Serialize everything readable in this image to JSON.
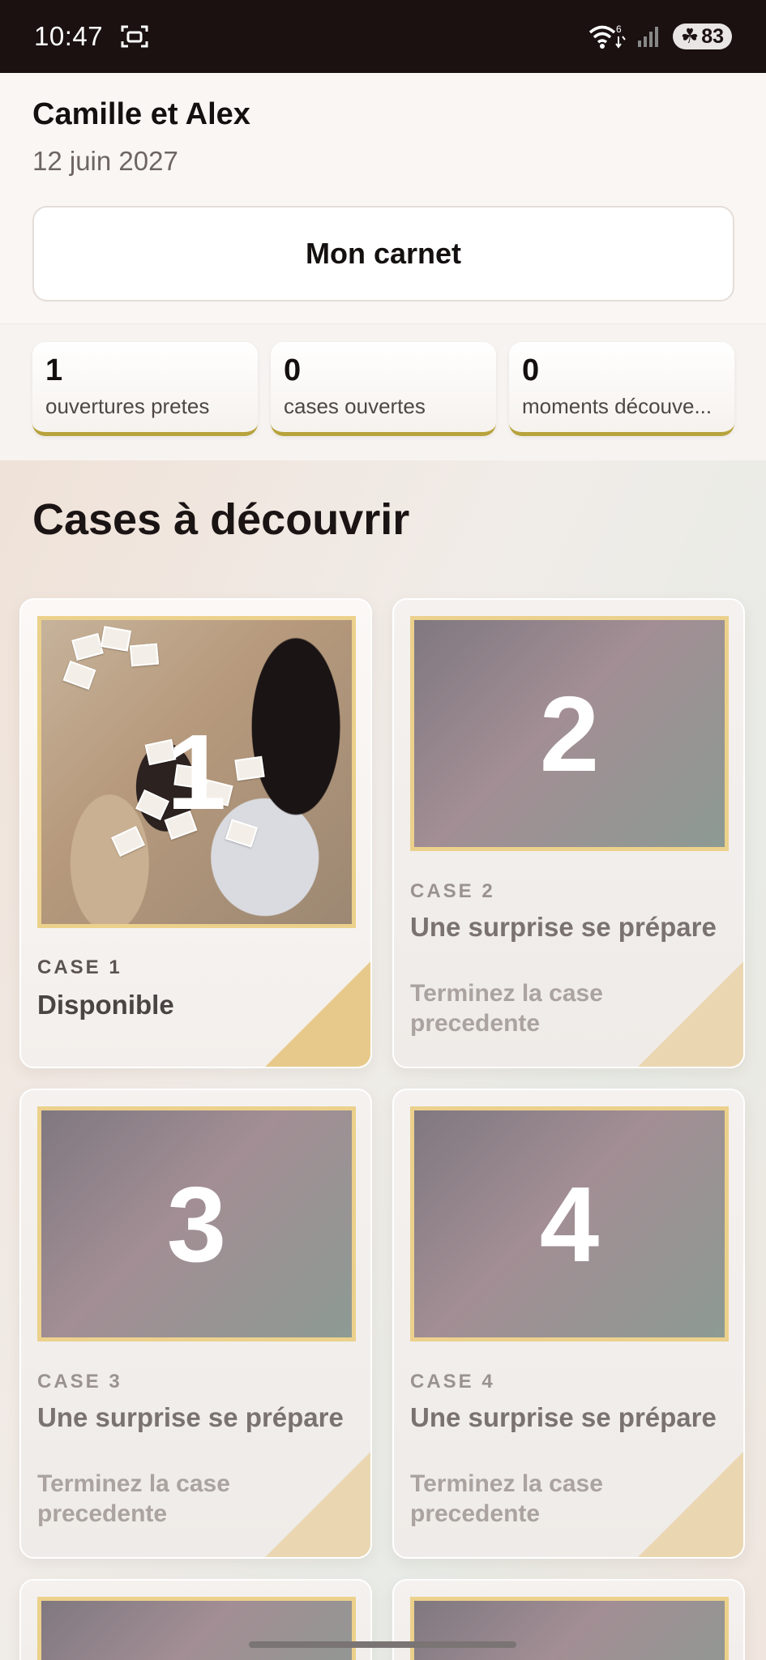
{
  "status_bar": {
    "time": "10:47",
    "network_badge": "6",
    "battery": "83"
  },
  "header": {
    "couple": "Camille et Alex",
    "date": "12 juin 2027",
    "carnet_button": "Mon carnet"
  },
  "stats": [
    {
      "value": "1",
      "label": "ouvertures pretes"
    },
    {
      "value": "0",
      "label": "cases ouvertes"
    },
    {
      "value": "0",
      "label": "moments découve..."
    }
  ],
  "section": {
    "title": "Cases à découvrir"
  },
  "cases": [
    {
      "number": "1",
      "label": "CASE 1",
      "title": "Disponible",
      "subtitle": ""
    },
    {
      "number": "2",
      "label": "CASE 2",
      "title": "Une surprise se prépare",
      "subtitle": "Terminez la case precedente"
    },
    {
      "number": "3",
      "label": "CASE 3",
      "title": "Une surprise se prépare",
      "subtitle": "Terminez la case precedente"
    },
    {
      "number": "4",
      "label": "CASE 4",
      "title": "Une surprise se prépare",
      "subtitle": "Terminez la case precedente"
    }
  ],
  "colors": {
    "accent_gold": "#ecd18c",
    "stat_underline": "#b7a33c",
    "status_bar_bg": "#1a1110"
  },
  "icons": [
    "screen-capture-icon",
    "wifi-icon",
    "signal-icon",
    "battery-leaf-icon"
  ]
}
